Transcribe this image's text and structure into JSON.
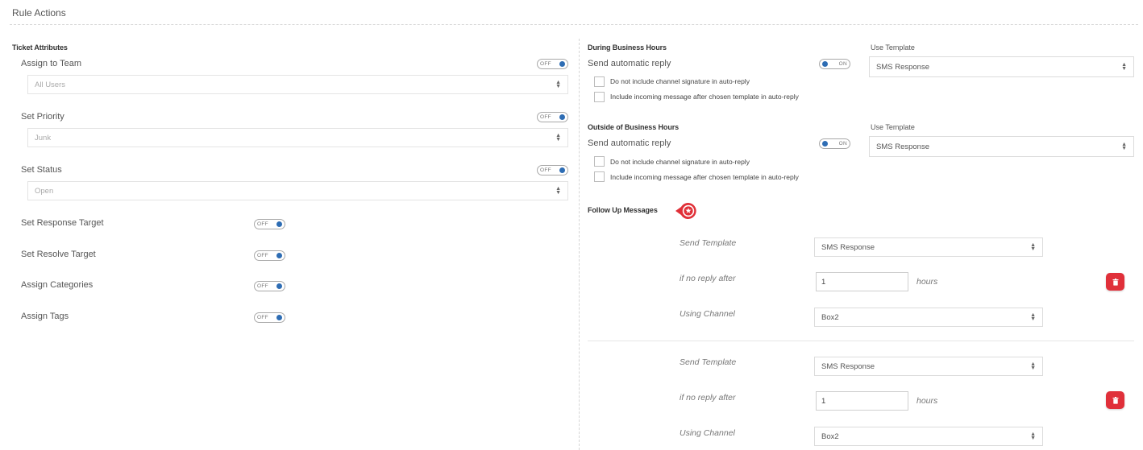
{
  "header": {
    "title": "Rule Actions"
  },
  "ticket_attributes": {
    "title": "Ticket Attributes",
    "assign_team": {
      "label": "Assign to Team",
      "toggle": "OFF",
      "select_value": "All Users"
    },
    "set_priority": {
      "label": "Set Priority",
      "toggle": "OFF",
      "select_value": "Junk"
    },
    "set_status": {
      "label": "Set Status",
      "toggle": "OFF",
      "select_value": "Open"
    },
    "response_target": {
      "label": "Set Response Target",
      "toggle": "OFF"
    },
    "resolve_target": {
      "label": "Set Resolve Target",
      "toggle": "OFF"
    },
    "categories": {
      "label": "Assign Categories",
      "toggle": "OFF"
    },
    "tags": {
      "label": "Assign Tags",
      "toggle": "OFF"
    }
  },
  "during_hours": {
    "title": "During Business Hours",
    "template_label": "Use Template",
    "auto_reply_label": "Send automatic reply",
    "toggle": "ON",
    "template_value": "SMS Response",
    "cb1": "Do not include channel signature in auto-reply",
    "cb2": "Include incoming message after chosen template in auto-reply"
  },
  "outside_hours": {
    "title": "Outside of Business Hours",
    "template_label": "Use Template",
    "auto_reply_label": "Send automatic reply",
    "toggle": "ON",
    "template_value": "SMS Response",
    "cb1": "Do not include channel signature in auto-reply",
    "cb2": "Include incoming message after chosen template in auto-reply"
  },
  "follow_up": {
    "title": "Follow Up Messages",
    "messages": [
      {
        "send_label": "Send Template",
        "template": "SMS Response",
        "if_label": "if no reply after",
        "hours_value": "1",
        "hours_unit": "hours",
        "channel_label": "Using Channel",
        "channel": "Box2"
      },
      {
        "send_label": "Send Template",
        "template": "SMS Response",
        "if_label": "if no reply after",
        "hours_value": "1",
        "hours_unit": "hours",
        "channel_label": "Using Channel",
        "channel": "Box2"
      }
    ]
  },
  "colors": {
    "toggle_knob": "#2e6db4",
    "delete": "#e0303a",
    "marker": "#e03038"
  },
  "icons": {
    "select": "chevron-updown-icon",
    "delete": "trash-icon",
    "marker": "settings-callout-icon"
  }
}
